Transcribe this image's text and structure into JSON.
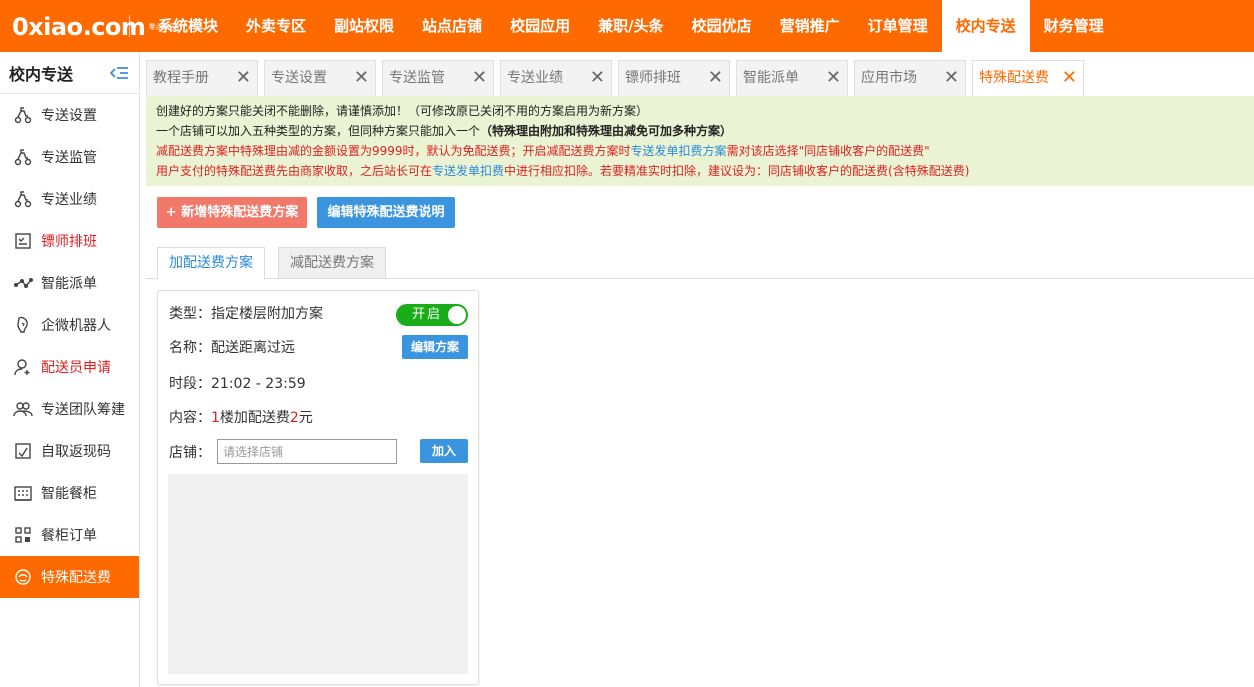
{
  "logo": {
    "text": "0xiao.com",
    "sub1": "零点校园",
    "sub2": ""
  },
  "nav": [
    "系统模块",
    "外卖专区",
    "副站权限",
    "站点店铺",
    "校园应用",
    "兼职/头条",
    "校园优店",
    "营销推广",
    "订单管理",
    "校内专送",
    "财务管理"
  ],
  "nav_active": "校内专送",
  "sidebar": {
    "title": "校内专送",
    "items": [
      {
        "label": "专送设置",
        "icon": "scooter-icon"
      },
      {
        "label": "专送监管",
        "icon": "scooter-icon"
      },
      {
        "label": "专送业绩",
        "icon": "scooter-icon"
      },
      {
        "label": "镖师排班",
        "icon": "schedule-icon"
      },
      {
        "label": "智能派单",
        "icon": "network-icon"
      },
      {
        "label": "企微机器人",
        "icon": "robot-icon"
      },
      {
        "label": "配送员申请",
        "icon": "user-add-icon"
      },
      {
        "label": "专送团队筹建",
        "icon": "team-icon"
      },
      {
        "label": "自取返现码",
        "icon": "qrcode-icon"
      },
      {
        "label": "智能餐柜",
        "icon": "building-icon"
      },
      {
        "label": "餐柜订单",
        "icon": "grid-icon"
      },
      {
        "label": "特殊配送费",
        "icon": "special-fee-icon"
      }
    ]
  },
  "tabs": [
    "教程手册",
    "专送设置",
    "专送监管",
    "专送业绩",
    "镖师排班",
    "智能派单",
    "应用市场",
    "特殊配送费"
  ],
  "notice": {
    "line1": "创建好的方案只能关闭不能删除，请谨慎添加！（可修改原已关闭不用的方案启用为新方案）",
    "line2a": "一个店铺可以加入五种类型的方案，但同种方案只能加入一个",
    "line2b": "（特殊理由附加和特殊理由减免可加多种方案）",
    "line3a": "减配送费方案中特殊理由减的金额设置为9999时，默认为免配送费；开启减配送费方案时",
    "line3b": "专送发单扣费方案",
    "line3c": "需对该店选择\"同店铺收客户的配送费\"",
    "line4a": "用户支付的特殊配送费先由商家收取，之后站长可在",
    "line4b": "专送发单扣费",
    "line4c": "中进行相应扣除。若要精准实时扣除，建议设为：同店铺收客户的配送费(含特殊配送费)"
  },
  "buttons": {
    "add": "+ 新增特殊配送费方案",
    "edit": "编辑特殊配送费说明"
  },
  "subtabs": [
    "加配送费方案",
    "减配送费方案"
  ],
  "card": {
    "type_label": "类型：",
    "type_value": "指定楼层附加方案",
    "toggle_label": "开启",
    "name_label": "名称：",
    "name_value": "配送距离过远",
    "edit_btn": "编辑方案",
    "time_label": "时段：",
    "time_value": "21:02 - 23:59",
    "content_label": "内容：",
    "content_floor": "1",
    "content_mid": "楼加配送费",
    "content_fee": "2",
    "content_unit": "元",
    "shop_label": "店铺：",
    "shop_placeholder": "请选择店铺",
    "join_btn": "加入"
  }
}
